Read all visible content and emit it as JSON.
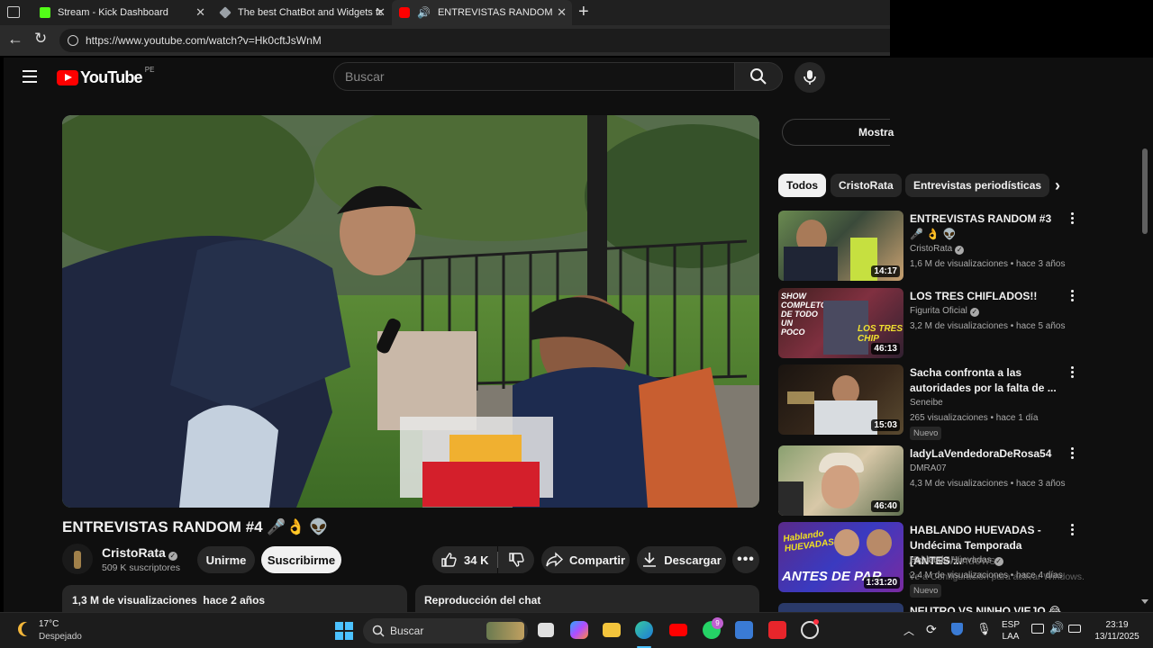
{
  "browser": {
    "tabs": [
      {
        "title": "Stream - Kick Dashboard",
        "favicon_color": "#53fc18"
      },
      {
        "title": "The best ChatBot and Widgets fo",
        "favicon_color": "#9aa0a6"
      },
      {
        "title": "ENTREVISTAS RANDOM #4 ",
        "favicon_color": "#ff0000"
      }
    ],
    "url": "https://www.youtube.com/watch?v=Hk0cftJsWnM"
  },
  "youtube": {
    "logo_text": "YouTube",
    "region": "PE",
    "search_placeholder": "Buscar",
    "video": {
      "title": "ENTREVISTAS RANDOM #4 🎤👌 👽",
      "channel": "CristoRata",
      "subscribers": "509 K suscriptores",
      "join_label": "Unirme",
      "subscribe_label": "Suscribirme",
      "likes": "34 K",
      "share_label": "Compartir",
      "download_label": "Descargar",
      "views_date": "1,3 M de visualizaciones  hace 2 años",
      "chat_replay": "Reproducción del chat"
    },
    "show_chat_label": "Mostra",
    "chips": [
      "Todos",
      "CristoRata",
      "Entrevistas periodísticas"
    ],
    "recommendations": [
      {
        "title": "ENTREVISTAS RANDOM #3 🎤 👌 👽",
        "channel": "CristoRata",
        "verified": true,
        "meta": "1,6 M de visualizaciones • hace 3 años",
        "duration": "14:17",
        "badge": ""
      },
      {
        "title": "LOS TRES CHIFLADOS!!",
        "channel": "Figurita Oficial",
        "verified": true,
        "meta": "3,2 M de visualizaciones • hace 5 años",
        "duration": "46:13",
        "badge": ""
      },
      {
        "title": "Sacha confronta a las autoridades por la falta de ...",
        "channel": "Seneibe",
        "verified": false,
        "meta": "265 visualizaciones • hace 1 día",
        "duration": "15:03",
        "badge": "Nuevo"
      },
      {
        "title": "ladyLaVendedoraDeRosa54",
        "channel": "DMRA07",
        "verified": false,
        "meta": "4,3 M de visualizaciones • hace 3 años",
        "duration": "46:40",
        "badge": ""
      },
      {
        "title": "HABLANDO HUEVADAS - Undécima Temporada [ANTES ...",
        "channel": "Hablando Huevadas",
        "verified": true,
        "meta": "2,4 M de visualizaciones • hace 4 días",
        "duration": "1:31:20",
        "badge": "Nuevo"
      },
      {
        "title": "NEUTRO VS NINHO VIEJO 😂",
        "channel": "",
        "verified": false,
        "meta": "",
        "duration": "",
        "badge": ""
      }
    ]
  },
  "windows_watermark": {
    "line1": "Activar Windows",
    "line2": "Ve a Configuración para activar Windows."
  },
  "taskbar": {
    "weather_temp": "17°C",
    "weather_desc": "Despejado",
    "search_label": "Buscar",
    "whatsapp_badge": "9",
    "language": "ESP",
    "layout": "LAA",
    "time": "23:19",
    "date": "13/11/2025"
  }
}
